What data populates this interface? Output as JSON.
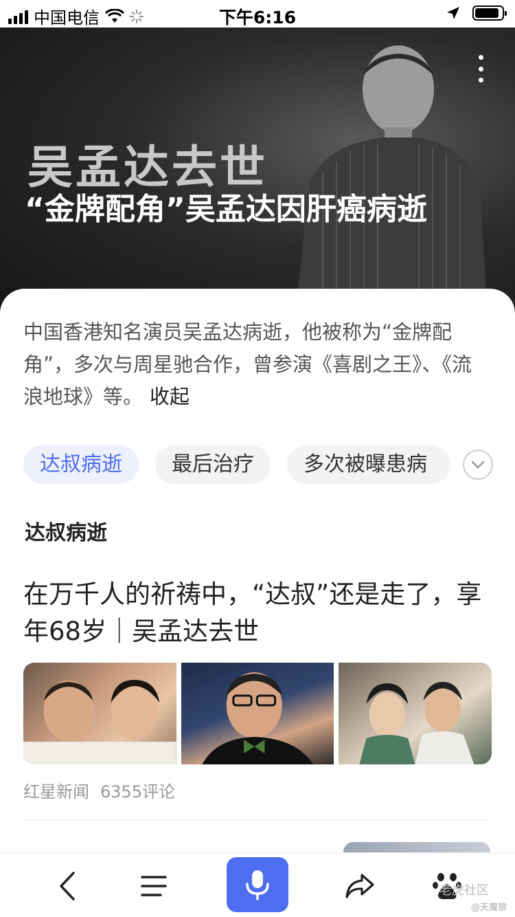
{
  "status_bar": {
    "carrier": "中国电信",
    "time": "下午6:16",
    "battery_level": 0.9
  },
  "hero": {
    "title": "吴孟达去世",
    "subtitle": "“金牌配角”吴孟达因肝癌病逝"
  },
  "summary": {
    "text": "中国香港知名演员吴孟达病逝，他被称为“金牌配角”，多次与周星驰合作，曾参演《喜剧之王》、《流浪地球》等。",
    "collapse_label": "收起"
  },
  "tabs": [
    {
      "label": "达叔病逝",
      "active": true
    },
    {
      "label": "最后治疗",
      "active": false
    },
    {
      "label": "多次被曝患病",
      "active": false
    }
  ],
  "section": {
    "title": "达叔病逝"
  },
  "news": {
    "title": "在万千人的祈祷中，“达叔”还是走了，享年68岁｜吴孟达去世",
    "source": "红星新闻",
    "comments": "6355评论"
  },
  "bottom_bar": {
    "icons": [
      "back-icon",
      "menu-icon",
      "mic-icon",
      "share-icon",
      "baidu-paw-icon"
    ],
    "accent": "#4e6ef2"
  },
  "watermark": {
    "line1": "老虎社区",
    "line2": "@天魔狼"
  }
}
